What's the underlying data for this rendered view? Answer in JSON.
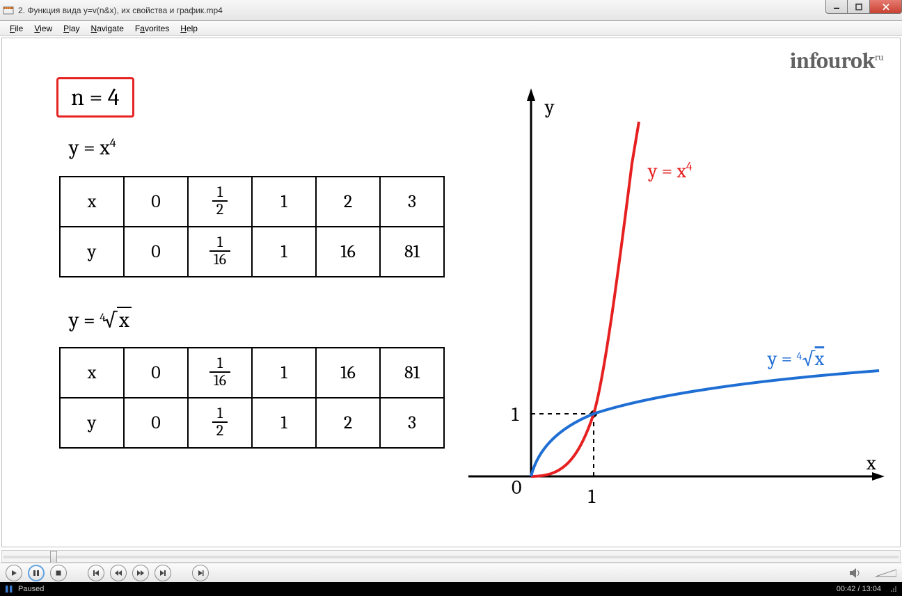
{
  "window": {
    "title": "2. Функция вида y=v(n&x), их свойства и график.mp4"
  },
  "menu": {
    "file": "File",
    "view": "View",
    "play": "Play",
    "navigate": "Navigate",
    "favorites": "Favorites",
    "help": "Help"
  },
  "slide": {
    "watermark": "infourok",
    "watermark_suffix": "ru",
    "n_box": "n = 4",
    "eq1_html": "y = x<span class='sup'>4</span>",
    "eq2_html": "y = <span class='pre'>4</span>√<span style='border-top:2px solid #000;padding:0 3px;'>x</span>",
    "table1": {
      "row1": [
        "x",
        "0",
        {
          "frac": [
            "1",
            "2"
          ]
        },
        "1",
        "2",
        "3"
      ],
      "row2": [
        "y",
        "0",
        {
          "frac": [
            "1",
            "16"
          ]
        },
        "1",
        "16",
        "81"
      ]
    },
    "table2": {
      "row1": [
        "x",
        "0",
        {
          "frac": [
            "1",
            "16"
          ]
        },
        "1",
        "16",
        "81"
      ],
      "row2": [
        "y",
        "0",
        {
          "frac": [
            "1",
            "2"
          ]
        },
        "1",
        "2",
        "3"
      ]
    },
    "graph": {
      "y_axis_label": "y",
      "x_axis_label": "x",
      "origin_label": "0",
      "tick_y": "1",
      "tick_x": "1",
      "red_label_html": "y = x<tspan font-size='18' dy='-10'>4</tspan>",
      "blue_label_html": "y = ⁴√x"
    }
  },
  "chart_data": {
    "type": "line",
    "title": "",
    "xlabel": "x",
    "ylabel": "y",
    "xlim_visible": [
      0,
      5.5
    ],
    "ylim_visible": [
      0,
      5.5
    ],
    "tick_x": [
      0,
      1
    ],
    "tick_y": [
      1
    ],
    "series": [
      {
        "name": "y = x^4",
        "color": "#e62020",
        "x": [
          0,
          0.5,
          1,
          2,
          3
        ],
        "y": [
          0,
          0.0625,
          1,
          16,
          81
        ]
      },
      {
        "name": "y = x^(1/4)",
        "color": "#1f6ed4",
        "x": [
          0,
          0.0625,
          1,
          16,
          81
        ],
        "y": [
          0,
          0.5,
          1,
          2,
          3
        ]
      }
    ],
    "annotations": [
      {
        "text": "y = x^4",
        "x": 2.2,
        "y": 5.0,
        "color": "#e62020"
      },
      {
        "text": "y = ⁴√x",
        "x": 4.6,
        "y": 1.6,
        "color": "#1f6ed4"
      }
    ],
    "intersection_marked": {
      "x": 1,
      "y": 1
    }
  },
  "seek": {
    "percent": 5.4
  },
  "status": {
    "state": "Paused",
    "time": "00:42 / 13:04"
  }
}
